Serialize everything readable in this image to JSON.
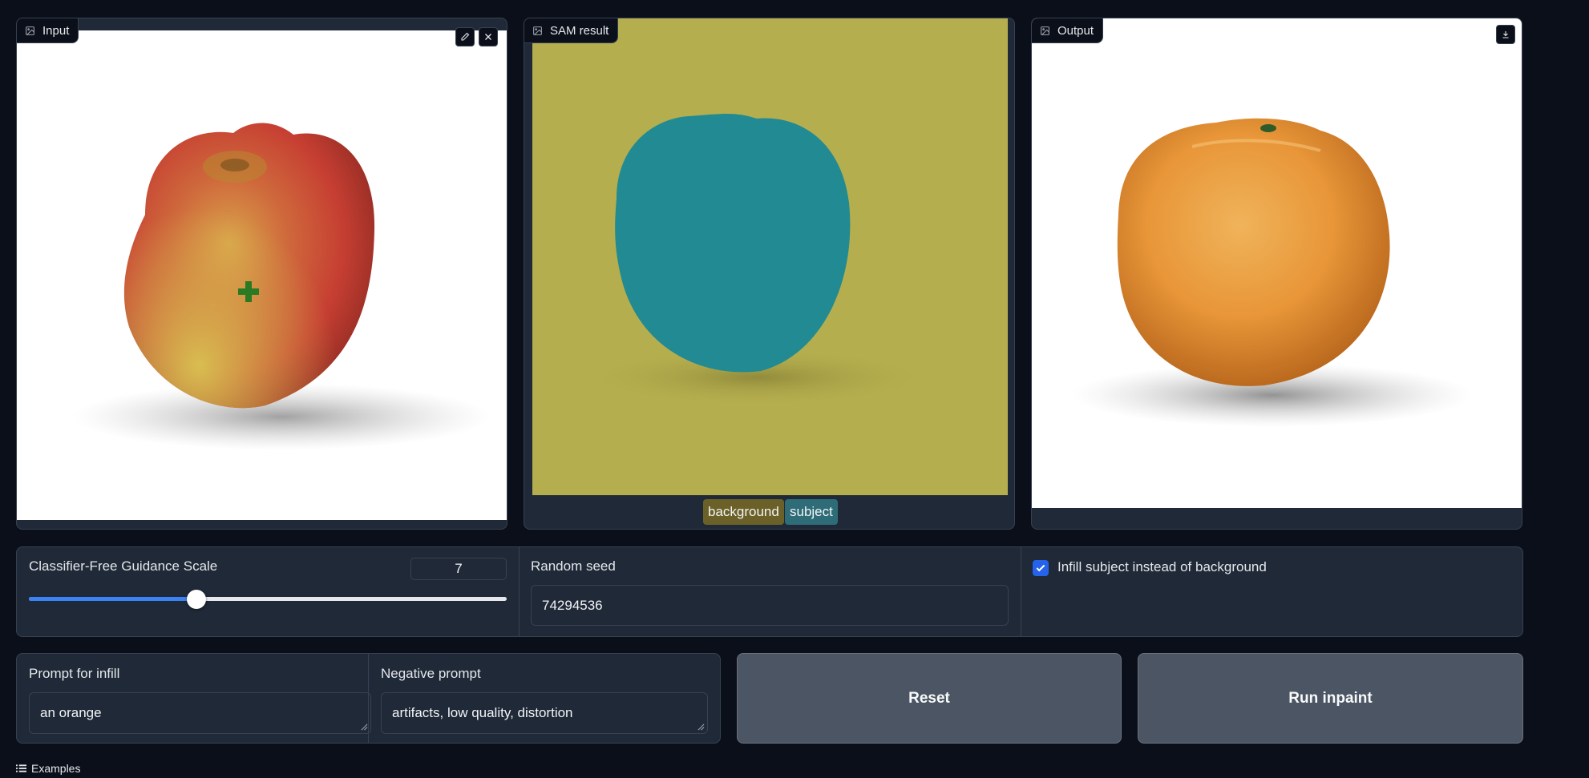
{
  "panels": {
    "input": {
      "label": "Input"
    },
    "sam_result": {
      "label": "SAM result",
      "legend": [
        {
          "label": "background",
          "color": "#6b6128"
        },
        {
          "label": "subject",
          "color": "#2e6d78"
        }
      ]
    },
    "output": {
      "label": "Output"
    }
  },
  "colors": {
    "page_background": "#0b0f19",
    "panel_background": "#1f2937",
    "accent": "#3b82f6",
    "checkbox": "#2563eb",
    "button": "#4b5563",
    "mask_background": "#b5ae4e",
    "mask_subject": "#218a92",
    "point_marker": "#2a7a23"
  },
  "settings": {
    "cfg": {
      "label": "Classifier-Free Guidance Scale",
      "value": "7",
      "slider_fraction": 0.35
    },
    "seed": {
      "label": "Random seed",
      "value": "74294536"
    },
    "infill": {
      "label": "Infill subject instead of background",
      "checked": true
    }
  },
  "prompts": {
    "prompt": {
      "label": "Prompt for infill",
      "value": "an orange"
    },
    "negative": {
      "label": "Negative prompt",
      "value": "artifacts, low quality, distortion"
    }
  },
  "buttons": {
    "reset": "Reset",
    "run": "Run inpaint"
  },
  "examples": {
    "label": "Examples"
  },
  "icons": {
    "panel_label": "image-icon",
    "edit": "pencil-icon",
    "clear": "close-icon",
    "download": "download-icon",
    "examples": "list-icon",
    "point": "plus-marker-icon"
  }
}
